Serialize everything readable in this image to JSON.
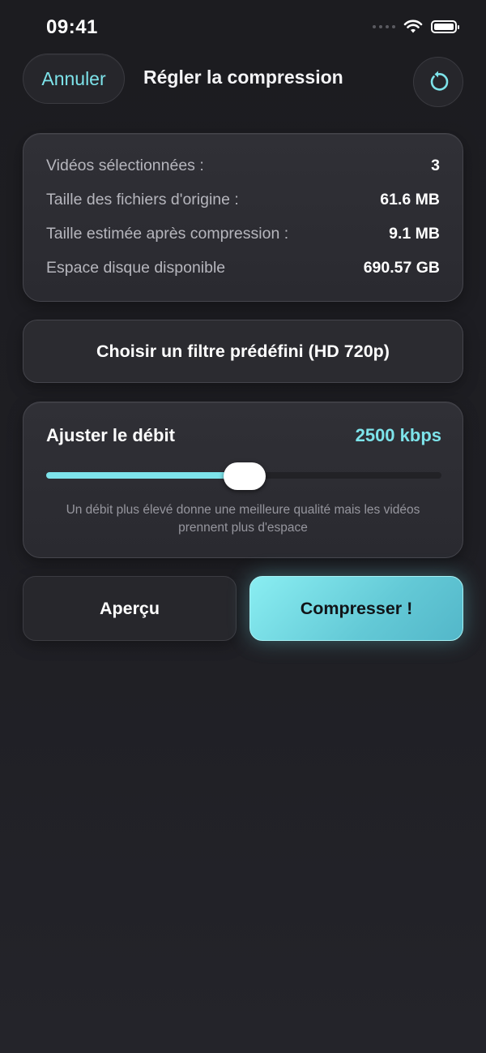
{
  "status_bar": {
    "time": "09:41",
    "icons": [
      "signal-dots-icon",
      "wifi-icon",
      "battery-icon"
    ]
  },
  "nav": {
    "cancel_label": "Annuler",
    "title": "Régler la compression",
    "reset_icon": "rotate-ccw-icon"
  },
  "info": {
    "rows": [
      {
        "label": "Vidéos sélectionnées :",
        "value": "3"
      },
      {
        "label": "Taille des fichiers d'origine :",
        "value": "61.6 MB"
      },
      {
        "label": "Taille estimée après compression :",
        "value": "9.1 MB"
      },
      {
        "label": "Espace disque disponible",
        "value": "690.57 GB"
      }
    ]
  },
  "preset": {
    "label": "Choisir un filtre prédéfini (HD 720p)"
  },
  "bitrate": {
    "title": "Ajuster le débit",
    "value_label": "2500 kbps",
    "slider_fraction": 0.5,
    "hint": "Un débit plus élevé donne une meilleure qualité mais les vidéos prennent plus d'espace"
  },
  "actions": {
    "preview_label": "Aperçu",
    "compress_label": "Compresser !"
  },
  "colors": {
    "accent": "#7de3ea",
    "background": "#1e1e23",
    "card": "#2d2d33"
  }
}
